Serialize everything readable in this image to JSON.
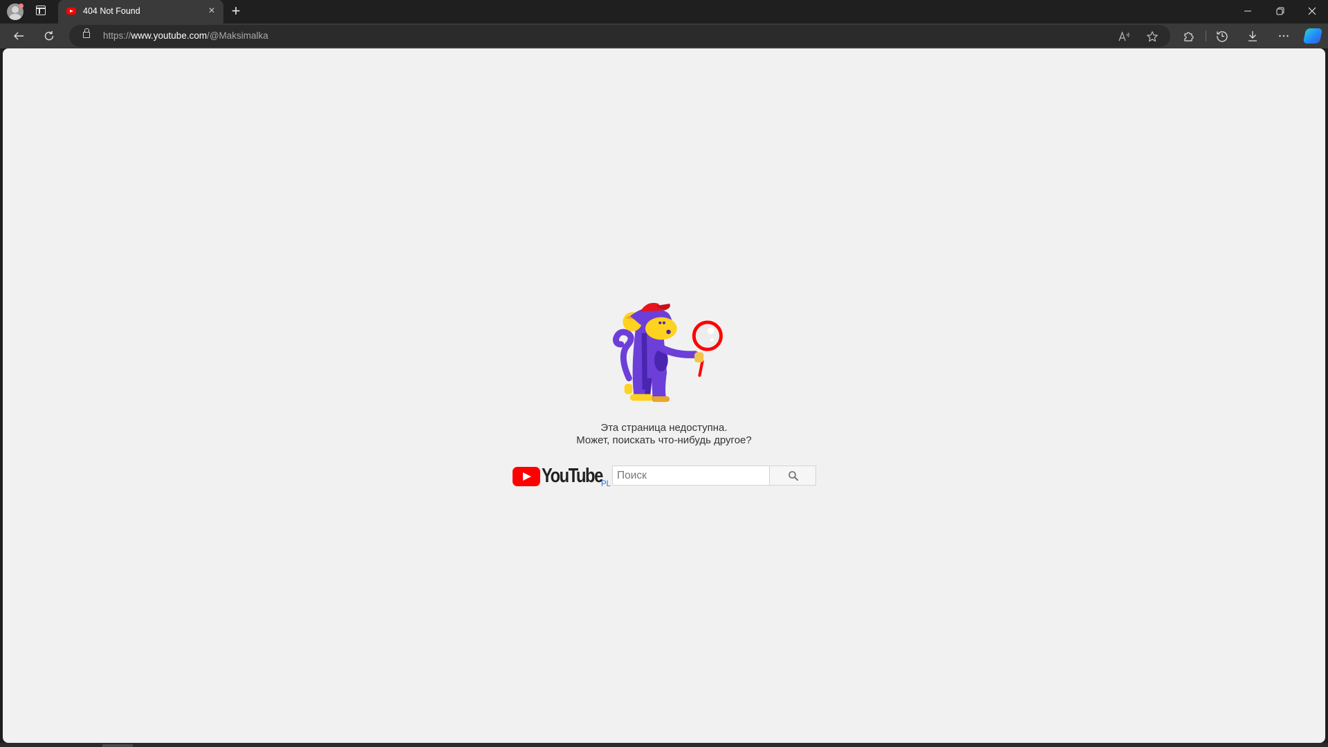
{
  "browser": {
    "tab": {
      "title": "404 Not Found",
      "favicon": "youtube-favicon"
    },
    "new_tab_label": "+",
    "close_tab_label": "×",
    "window_controls": {
      "minimize": "—",
      "restore": "❐",
      "close": "✕"
    },
    "address": {
      "scheme": "https://",
      "host": "www.youtube.com",
      "path": "/@Maksimalka"
    },
    "toolbar_icons": [
      "back-icon",
      "refresh-icon",
      "lock-icon",
      "read-aloud-icon",
      "favorite-star-icon",
      "extensions-icon",
      "history-icon",
      "download-icon",
      "more-icon",
      "copilot-icon"
    ]
  },
  "page": {
    "illustration": "monkey-with-magnifier",
    "message_line1": "Эта страница недоступна.",
    "message_line2": "Может, поискать что-нибудь другое?",
    "logo_text": "YouTube",
    "logo_region": "PL",
    "search": {
      "placeholder": "Поиск",
      "value": ""
    },
    "colors": {
      "brand_red": "#ff0000",
      "region_blue": "#2a73d8",
      "background": "#f1f1f1"
    }
  }
}
